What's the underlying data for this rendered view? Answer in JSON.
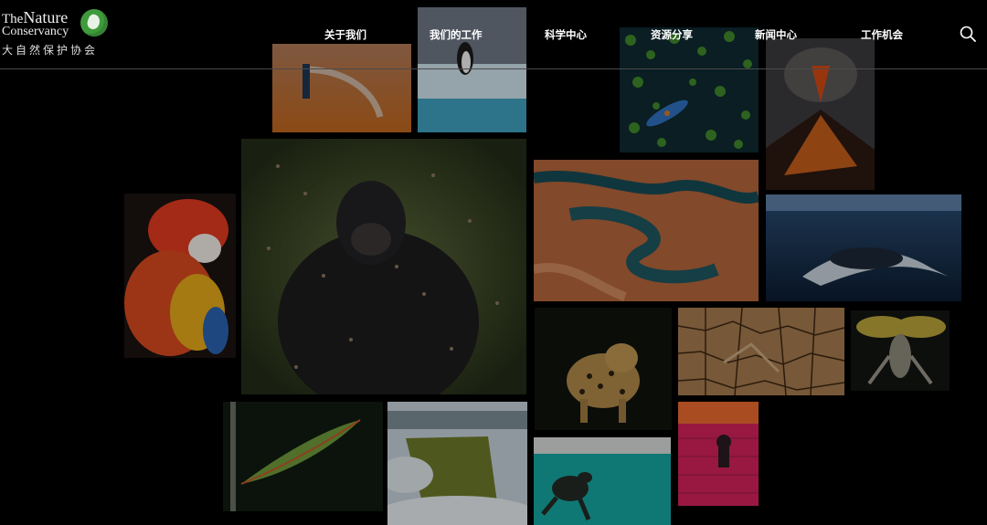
{
  "logo": {
    "name_line1_a": "The",
    "name_line1_b": "Nature",
    "name_line2": "Conservancy",
    "name_cn": "大自然保护协会"
  },
  "nav": [
    {
      "label": "关于我们"
    },
    {
      "label": "我们的工作"
    },
    {
      "label": "科学中心"
    },
    {
      "label": "资源分享"
    },
    {
      "label": "新闻中心"
    },
    {
      "label": "工作机会"
    }
  ],
  "icons": {
    "search": "search-icon",
    "logo_mark": "globe-leaf-icon"
  },
  "colors": {
    "background": "#000000",
    "brand_green": "#3f9a3c",
    "divider": "#4a4a4a"
  },
  "gallery": [
    "photo-desert-figure",
    "photo-penguin-ice",
    "photo-lilypads-kayak",
    "photo-volcano",
    "photo-gorilla-butterflies",
    "photo-macaw",
    "photo-canyon-river",
    "photo-humpback-whale",
    "photo-leopard",
    "photo-cracked-earth",
    "photo-moth",
    "photo-leaf-insect",
    "photo-mesa-clouds",
    "photo-sea-turtle",
    "photo-pink-building"
  ]
}
